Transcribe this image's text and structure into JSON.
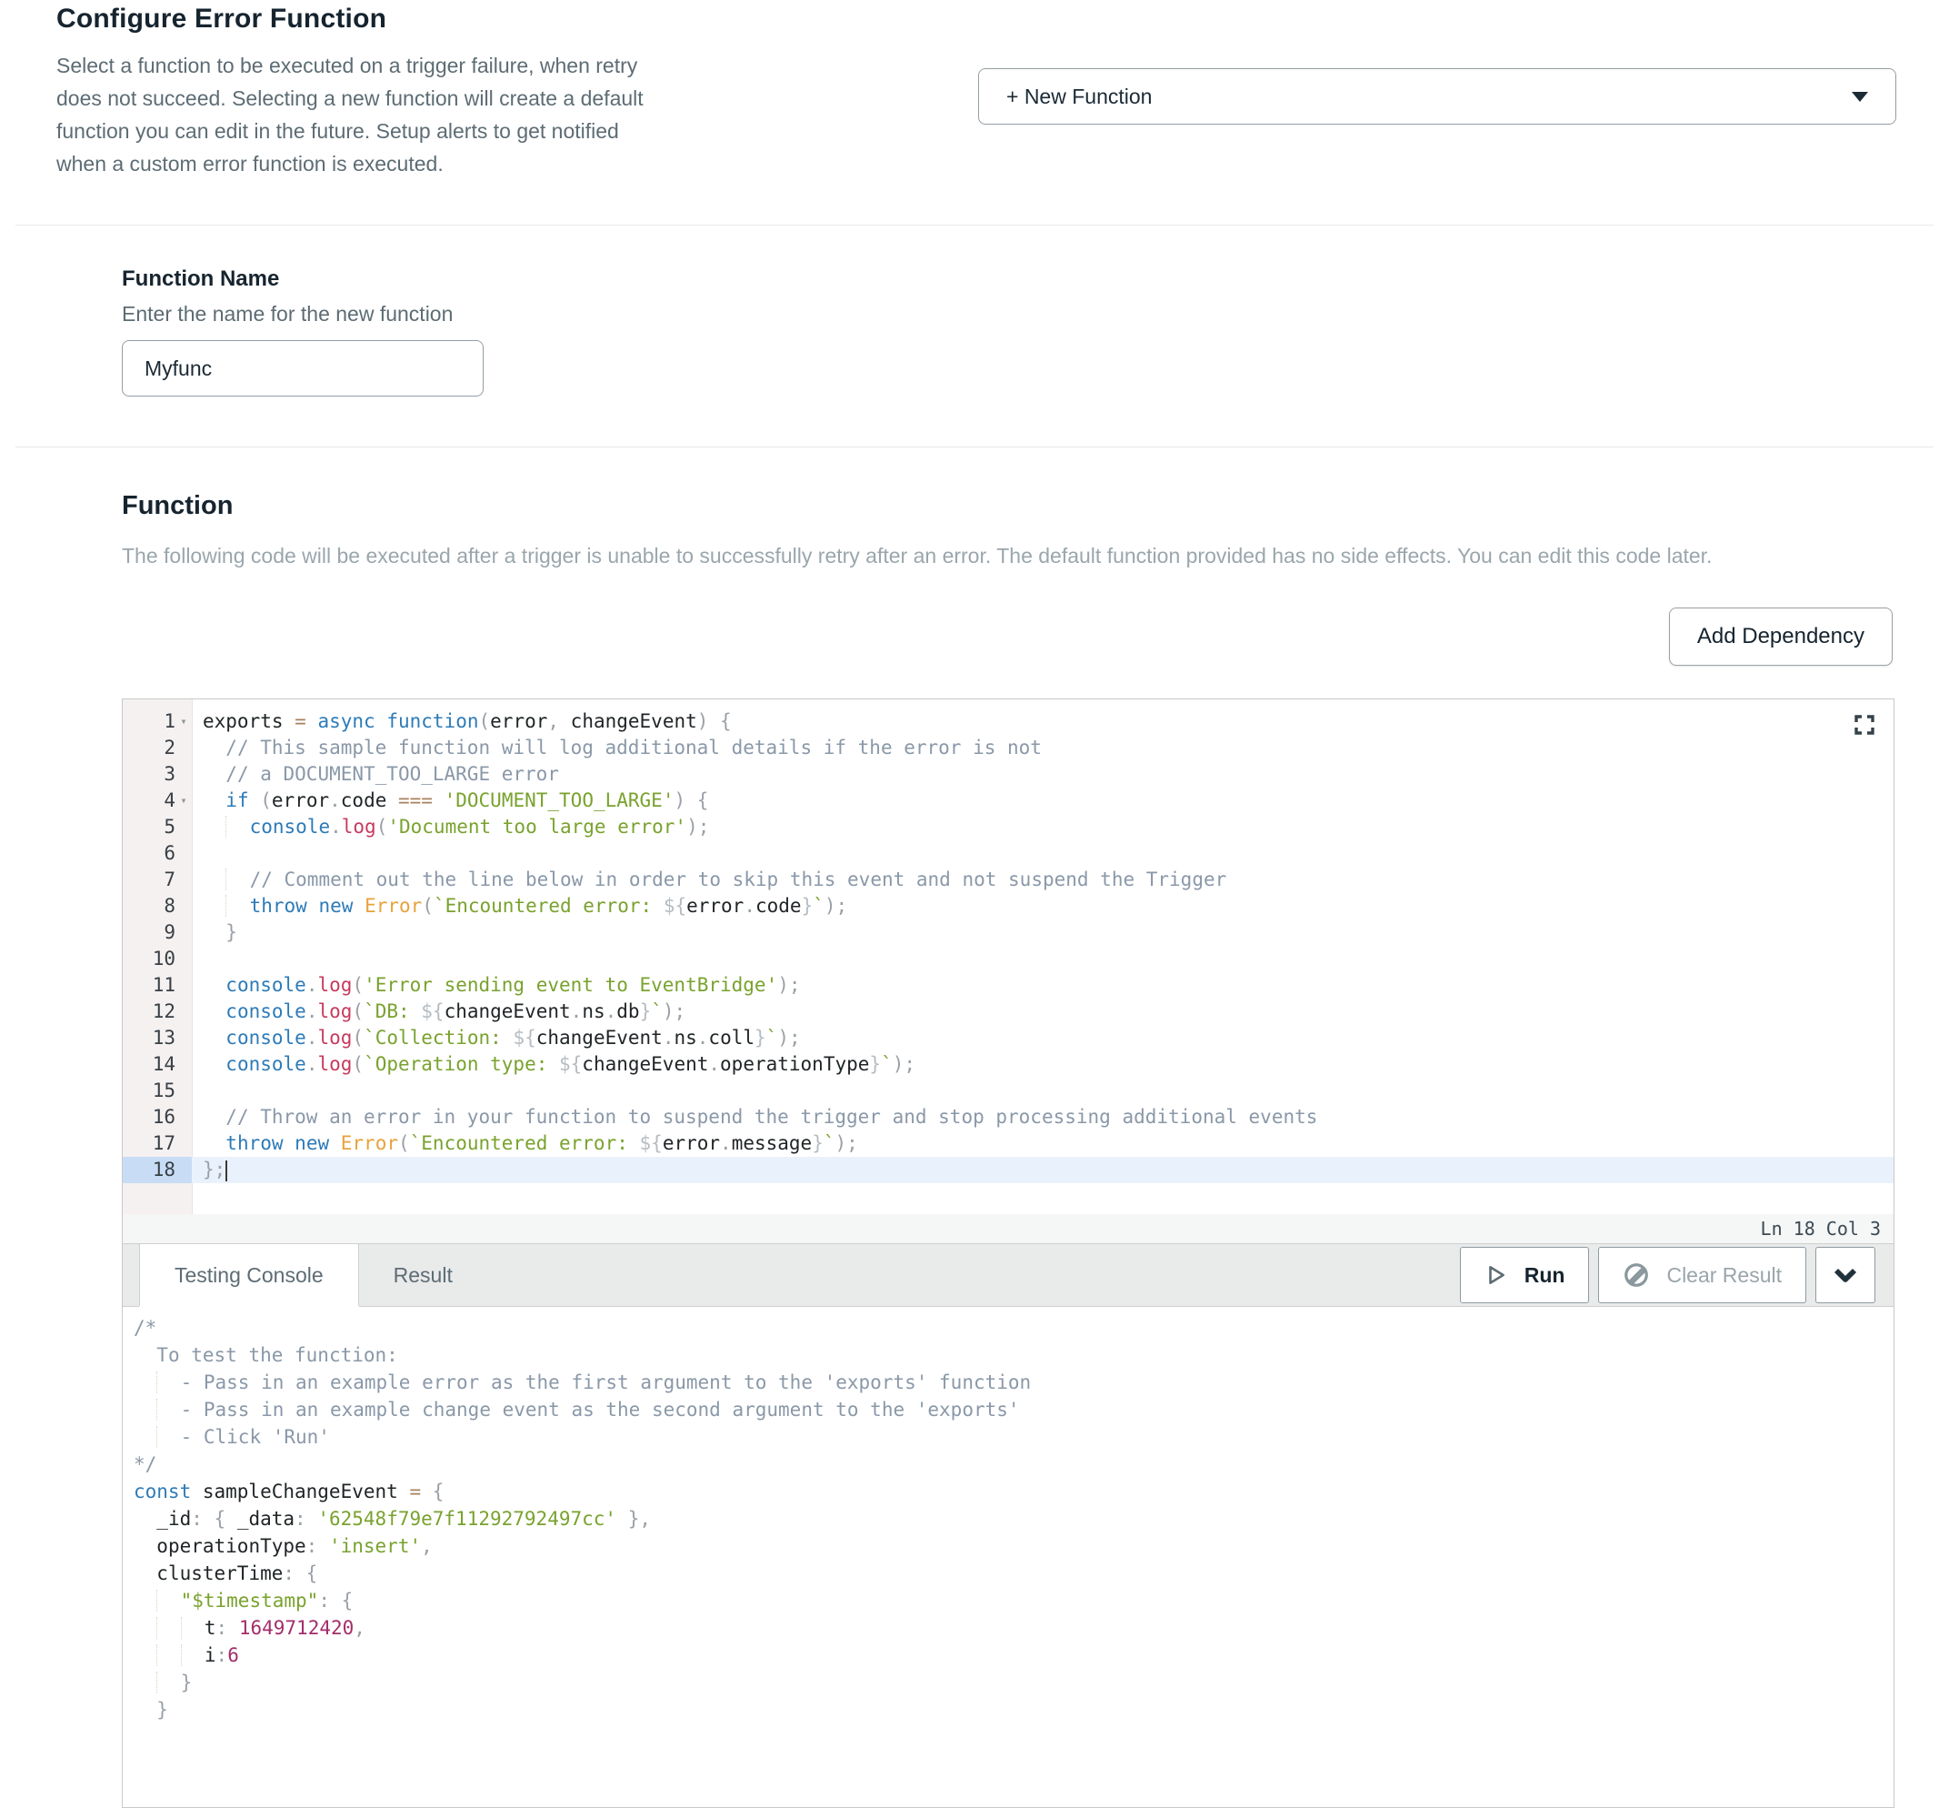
{
  "header": {
    "title": "Configure Error Function",
    "description": "Select a function to be executed on a trigger failure, when retry does not succeed. Selecting a new function will create a default function you can edit in the future. Setup alerts to get notified when a custom error function is executed."
  },
  "function_select": {
    "value": "+ New Function"
  },
  "function_name": {
    "label": "Function Name",
    "description": "Enter the name for the new function",
    "value": "Myfunc"
  },
  "function_section": {
    "label": "Function",
    "description": "The following code will be executed after a trigger is unable to successfully retry after an error. The default function provided has no side effects. You can edit this code later.",
    "add_dependency_label": "Add Dependency"
  },
  "editor": {
    "status_line": "Ln 18 Col 3",
    "active_line": 18,
    "lines": [
      {
        "num": 1,
        "fold": true,
        "indent": 0,
        "tokens": [
          [
            "d",
            "exports "
          ],
          [
            "o",
            "="
          ],
          [
            "d",
            " "
          ],
          [
            "k",
            "async"
          ],
          [
            "d",
            " "
          ],
          [
            "k",
            "function"
          ],
          [
            "p",
            "("
          ],
          [
            "d",
            "error"
          ],
          [
            "p",
            ", "
          ],
          [
            "d",
            "changeEvent"
          ],
          [
            "p",
            ") "
          ],
          [
            "p",
            "{"
          ]
        ]
      },
      {
        "num": 2,
        "indent": 2,
        "tokens": [
          [
            "c",
            "// This sample function will log additional details if the error is not"
          ]
        ]
      },
      {
        "num": 3,
        "indent": 2,
        "tokens": [
          [
            "c",
            "// a DOCUMENT_TOO_LARGE error"
          ]
        ]
      },
      {
        "num": 4,
        "fold": true,
        "indent": 2,
        "tokens": [
          [
            "k",
            "if"
          ],
          [
            "d",
            " "
          ],
          [
            "p",
            "("
          ],
          [
            "d",
            "error"
          ],
          [
            "p",
            "."
          ],
          [
            "d",
            "code"
          ],
          [
            "d",
            " "
          ],
          [
            "o",
            "==="
          ],
          [
            "d",
            " "
          ],
          [
            "s",
            "'DOCUMENT_TOO_LARGE'"
          ],
          [
            "p",
            ")"
          ],
          [
            "d",
            " "
          ],
          [
            "p",
            "{"
          ]
        ]
      },
      {
        "num": 5,
        "indent": 4,
        "tokens": [
          [
            "fn",
            "console"
          ],
          [
            "p",
            "."
          ],
          [
            "m",
            "log"
          ],
          [
            "p",
            "("
          ],
          [
            "s",
            "'Document too large error'"
          ],
          [
            "p",
            ");"
          ]
        ]
      },
      {
        "num": 6,
        "indent": 0,
        "tokens": []
      },
      {
        "num": 7,
        "indent": 4,
        "tokens": [
          [
            "c",
            "// Comment out the line below in order to skip this event and not suspend the Trigger"
          ]
        ]
      },
      {
        "num": 8,
        "indent": 4,
        "tokens": [
          [
            "k",
            "throw"
          ],
          [
            "d",
            " "
          ],
          [
            "k",
            "new"
          ],
          [
            "d",
            " "
          ],
          [
            "cl",
            "Error"
          ],
          [
            "p",
            "("
          ],
          [
            "s",
            "`Encountered error: "
          ],
          [
            "i",
            "${"
          ],
          [
            "d",
            "error"
          ],
          [
            "p",
            "."
          ],
          [
            "d",
            "code"
          ],
          [
            "i",
            "}"
          ],
          [
            "s",
            "`"
          ],
          [
            "p",
            ");"
          ]
        ]
      },
      {
        "num": 9,
        "indent": 2,
        "tokens": [
          [
            "p",
            "}"
          ]
        ]
      },
      {
        "num": 10,
        "indent": 0,
        "tokens": []
      },
      {
        "num": 11,
        "indent": 2,
        "tokens": [
          [
            "fn",
            "console"
          ],
          [
            "p",
            "."
          ],
          [
            "m",
            "log"
          ],
          [
            "p",
            "("
          ],
          [
            "s",
            "'Error sending event to EventBridge'"
          ],
          [
            "p",
            ");"
          ]
        ]
      },
      {
        "num": 12,
        "indent": 2,
        "tokens": [
          [
            "fn",
            "console"
          ],
          [
            "p",
            "."
          ],
          [
            "m",
            "log"
          ],
          [
            "p",
            "("
          ],
          [
            "s",
            "`DB: "
          ],
          [
            "i",
            "${"
          ],
          [
            "d",
            "changeEvent"
          ],
          [
            "p",
            "."
          ],
          [
            "d",
            "ns"
          ],
          [
            "p",
            "."
          ],
          [
            "d",
            "db"
          ],
          [
            "i",
            "}"
          ],
          [
            "s",
            "`"
          ],
          [
            "p",
            ");"
          ]
        ]
      },
      {
        "num": 13,
        "indent": 2,
        "tokens": [
          [
            "fn",
            "console"
          ],
          [
            "p",
            "."
          ],
          [
            "m",
            "log"
          ],
          [
            "p",
            "("
          ],
          [
            "s",
            "`Collection: "
          ],
          [
            "i",
            "${"
          ],
          [
            "d",
            "changeEvent"
          ],
          [
            "p",
            "."
          ],
          [
            "d",
            "ns"
          ],
          [
            "p",
            "."
          ],
          [
            "d",
            "coll"
          ],
          [
            "i",
            "}"
          ],
          [
            "s",
            "`"
          ],
          [
            "p",
            ");"
          ]
        ]
      },
      {
        "num": 14,
        "indent": 2,
        "tokens": [
          [
            "fn",
            "console"
          ],
          [
            "p",
            "."
          ],
          [
            "m",
            "log"
          ],
          [
            "p",
            "("
          ],
          [
            "s",
            "`Operation type: "
          ],
          [
            "i",
            "${"
          ],
          [
            "d",
            "changeEvent"
          ],
          [
            "p",
            "."
          ],
          [
            "d",
            "operationType"
          ],
          [
            "i",
            "}"
          ],
          [
            "s",
            "`"
          ],
          [
            "p",
            ");"
          ]
        ]
      },
      {
        "num": 15,
        "indent": 0,
        "tokens": []
      },
      {
        "num": 16,
        "indent": 2,
        "tokens": [
          [
            "c",
            "// Throw an error in your function to suspend the trigger and stop processing additional events"
          ]
        ]
      },
      {
        "num": 17,
        "indent": 2,
        "tokens": [
          [
            "k",
            "throw"
          ],
          [
            "d",
            " "
          ],
          [
            "k",
            "new"
          ],
          [
            "d",
            " "
          ],
          [
            "cl",
            "Error"
          ],
          [
            "p",
            "("
          ],
          [
            "s",
            "`Encountered error: "
          ],
          [
            "i",
            "${"
          ],
          [
            "d",
            "error"
          ],
          [
            "p",
            "."
          ],
          [
            "d",
            "message"
          ],
          [
            "i",
            "}"
          ],
          [
            "s",
            "`"
          ],
          [
            "p",
            ");"
          ]
        ]
      },
      {
        "num": 18,
        "indent": 0,
        "tokens": [
          [
            "p",
            "};"
          ],
          [
            "cur",
            ""
          ]
        ]
      }
    ]
  },
  "testing_console": {
    "tabs": [
      {
        "label": "Testing Console",
        "active": true
      },
      {
        "label": "Result",
        "active": false
      }
    ],
    "run_label": "Run",
    "clear_result_label": "Clear Result",
    "lines": [
      {
        "indent": 0,
        "tokens": [
          [
            "c",
            "/*"
          ]
        ]
      },
      {
        "indent": 2,
        "tokens": [
          [
            "c",
            "To test the function:"
          ]
        ]
      },
      {
        "indent": 4,
        "tokens": [
          [
            "c",
            "- Pass in an example error as the first argument to the 'exports' function"
          ]
        ]
      },
      {
        "indent": 4,
        "tokens": [
          [
            "c",
            "- Pass in an example change event as the second argument to the 'exports'"
          ]
        ]
      },
      {
        "indent": 4,
        "tokens": [
          [
            "c",
            "- Click 'Run'"
          ]
        ]
      },
      {
        "indent": 0,
        "tokens": [
          [
            "c",
            "*/"
          ]
        ]
      },
      {
        "indent": 0,
        "tokens": [
          [
            "k",
            "const"
          ],
          [
            "d",
            " sampleChangeEvent "
          ],
          [
            "o",
            "="
          ],
          [
            "d",
            " "
          ],
          [
            "p",
            "{"
          ]
        ]
      },
      {
        "indent": 2,
        "tokens": [
          [
            "d",
            "_id"
          ],
          [
            "p",
            ": "
          ],
          [
            "p",
            "{"
          ],
          [
            "d",
            " _data"
          ],
          [
            "p",
            ": "
          ],
          [
            "s",
            "'62548f79e7f11292792497cc'"
          ],
          [
            "d",
            " "
          ],
          [
            "p",
            "},"
          ]
        ]
      },
      {
        "indent": 2,
        "tokens": [
          [
            "d",
            "operationType"
          ],
          [
            "p",
            ": "
          ],
          [
            "s",
            "'insert'"
          ],
          [
            "p",
            ","
          ]
        ]
      },
      {
        "indent": 2,
        "tokens": [
          [
            "d",
            "clusterTime"
          ],
          [
            "p",
            ": "
          ],
          [
            "p",
            "{"
          ]
        ]
      },
      {
        "indent": 4,
        "tokens": [
          [
            "s",
            "\"$timestamp\""
          ],
          [
            "p",
            ": "
          ],
          [
            "p",
            "{"
          ]
        ]
      },
      {
        "indent": 6,
        "tokens": [
          [
            "d",
            "t"
          ],
          [
            "p",
            ": "
          ],
          [
            "n",
            "1649712420"
          ],
          [
            "p",
            ","
          ]
        ]
      },
      {
        "indent": 6,
        "tokens": [
          [
            "d",
            "i"
          ],
          [
            "p",
            ":"
          ],
          [
            "n",
            "6"
          ]
        ]
      },
      {
        "indent": 4,
        "tokens": [
          [
            "p",
            "}"
          ]
        ]
      },
      {
        "indent": 2,
        "tokens": [
          [
            "p",
            "}"
          ]
        ]
      }
    ]
  },
  "colors": {
    "heading": "#16242f",
    "body_text": "#5d6c74",
    "muted_text": "#9aa6ac",
    "keyword_blue": "#2d7bb8",
    "string_green": "#79a22e",
    "comment_slate": "#8a98a8",
    "class_orange": "#e8a23b",
    "number_magenta": "#a32d6a",
    "operator_tan": "#a8805c",
    "active_line_bg": "#e9f2fc"
  }
}
